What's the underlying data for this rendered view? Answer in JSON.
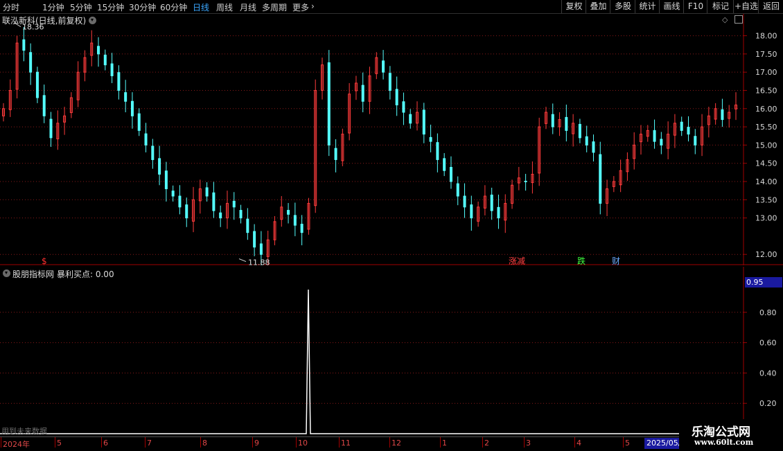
{
  "toolbar": {
    "periods": [
      "分时",
      "1分钟",
      "5分钟",
      "15分钟",
      "30分钟",
      "60分钟",
      "日线",
      "周线",
      "月线",
      "多周期",
      "更多"
    ],
    "active_period": "日线",
    "more_arrow": "›",
    "buttons": [
      "复权",
      "叠加",
      "多股",
      "统计",
      "画线",
      "F10",
      "标记",
      "+自选",
      "返回"
    ]
  },
  "main_chart": {
    "title": "联泓新科(日线,前复权)",
    "high_label": "18.36",
    "low_label": "11.88",
    "price_ticks": [
      "18.00",
      "17.50",
      "17.00",
      "16.50",
      "16.00",
      "15.50",
      "15.00",
      "14.50",
      "14.00",
      "13.50",
      "13.00",
      "12.00"
    ],
    "event_marks": [
      "$",
      "涨减",
      "跌",
      "财"
    ],
    "colors": {
      "up": "#ff3b3b",
      "down": "#54ffff",
      "grid": "#8a1a1a",
      "axis": "#a00000"
    }
  },
  "indicator": {
    "title": "股朋指标网",
    "series_label": "暴利买点: 0.00",
    "current_value": "0.95",
    "ticks": [
      "0.80",
      "0.60",
      "0.40",
      "0.20"
    ],
    "footer_note": "用到未来数据"
  },
  "xaxis": {
    "labels": [
      "2024年",
      "5",
      "6",
      "7",
      "8",
      "9",
      "10",
      "11",
      "12",
      "1",
      "2",
      "3",
      "4",
      "5"
    ],
    "cursor_date": "2025/05/"
  },
  "watermark": {
    "title": "乐淘公式网",
    "url": "www.60lt.com"
  },
  "chart_data": {
    "type": "candlestick",
    "title": "联泓新科(日线,前复权)",
    "y_range": [
      11.7,
      18.6
    ],
    "price_high": 18.36,
    "price_low": 11.88,
    "close_series": [
      16.0,
      16.5,
      17.8,
      17.6,
      17.0,
      16.3,
      15.8,
      15.2,
      15.6,
      15.8,
      16.3,
      17.0,
      17.4,
      17.8,
      17.5,
      17.2,
      16.9,
      16.5,
      16.2,
      15.8,
      15.4,
      15.0,
      14.6,
      14.2,
      13.8,
      13.6,
      13.3,
      13.0,
      13.5,
      13.8,
      13.6,
      13.2,
      13.0,
      13.4,
      13.3,
      13.0,
      12.6,
      12.2,
      12.0,
      12.4,
      12.9,
      13.3,
      13.1,
      12.8,
      12.6,
      13.4,
      16.5,
      17.2,
      15.0,
      14.6,
      15.3,
      16.4,
      16.7,
      16.2,
      16.9,
      17.4,
      17.0,
      16.5,
      16.1,
      15.9,
      15.6,
      15.9,
      15.3,
      15.1,
      14.6,
      14.3,
      14.0,
      13.6,
      13.3,
      13.0,
      13.3,
      13.6,
      13.2,
      13.0,
      13.4,
      13.9,
      14.1,
      14.0,
      14.2,
      15.5,
      15.9,
      15.5,
      15.7,
      15.4,
      15.6,
      15.2,
      15.0,
      14.8,
      13.4,
      13.8,
      14.0,
      14.3,
      14.6,
      15.0,
      15.3,
      15.4,
      15.1,
      15.0,
      15.3,
      15.6,
      15.4,
      15.3,
      15.0,
      15.5,
      15.8,
      16.0,
      15.7,
      15.9,
      16.1
    ],
    "indicator_series": {
      "name": "暴利买点",
      "spike_value": 0.95,
      "spike_position": "2024-10 early",
      "baseline": 0.0
    },
    "x_labels": [
      "2024年",
      "5",
      "6",
      "7",
      "8",
      "9",
      "10",
      "11",
      "12",
      "1",
      "2",
      "3",
      "4",
      "5"
    ]
  }
}
